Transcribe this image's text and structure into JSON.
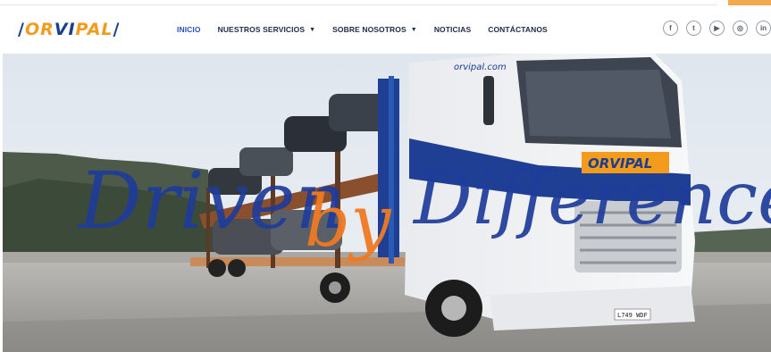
{
  "brand": {
    "logo_part1": "OR",
    "logo_part2": "VI",
    "logo_part3": "PAL"
  },
  "nav": {
    "items": [
      {
        "label": "INICIO",
        "active": true,
        "dropdown": false
      },
      {
        "label": "NUESTROS SERVICIOS",
        "active": false,
        "dropdown": true
      },
      {
        "label": "SOBRE NOSOTROS",
        "active": false,
        "dropdown": true
      },
      {
        "label": "NOTICIAS",
        "active": false,
        "dropdown": false
      },
      {
        "label": "CONTÁCTANOS",
        "active": false,
        "dropdown": false
      }
    ]
  },
  "socials": [
    {
      "icon": "facebook-icon",
      "glyph": "f"
    },
    {
      "icon": "twitter-icon",
      "glyph": "t"
    },
    {
      "icon": "youtube-icon",
      "glyph": "▶"
    },
    {
      "icon": "instagram-icon",
      "glyph": "◎"
    },
    {
      "icon": "linkedin-icon",
      "glyph": "in"
    }
  ],
  "hero": {
    "tagline_word1": "Driven",
    "tagline_word2": "by",
    "tagline_word3": "Difference",
    "truck_brand": "ORVIPAL",
    "truck_website": "orvipal.com",
    "license_plate": "L749 WDF"
  },
  "colors": {
    "brand_blue": "#1b3e8f",
    "brand_orange": "#f29b1d",
    "nav_active": "#2a52b8",
    "nav_text": "#1d2b44"
  }
}
